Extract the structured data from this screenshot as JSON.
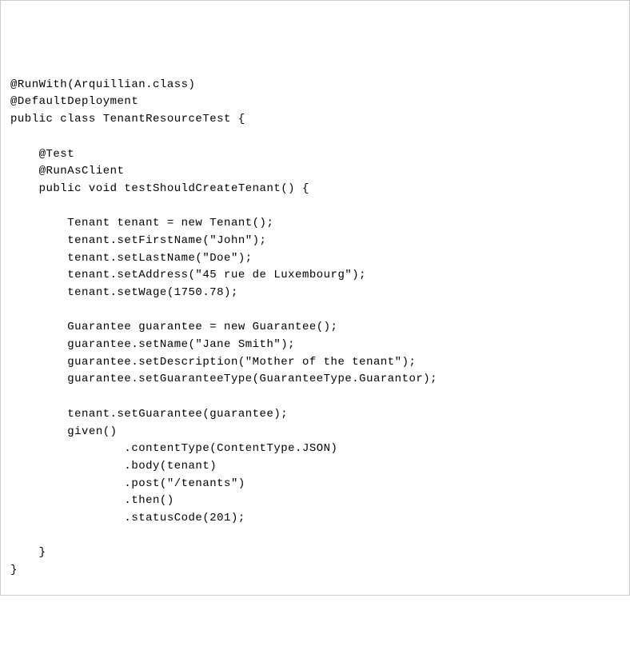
{
  "code": {
    "line1": "@RunWith(Arquillian.class)",
    "line2": "@DefaultDeployment",
    "line3": "public class TenantResourceTest {",
    "line4": "",
    "line5": "    @Test",
    "line6": "    @RunAsClient",
    "line7": "    public void testShouldCreateTenant() {",
    "line8": "",
    "line9": "        Tenant tenant = new Tenant();",
    "line10": "        tenant.setFirstName(\"John\");",
    "line11": "        tenant.setLastName(\"Doe\");",
    "line12": "        tenant.setAddress(\"45 rue de Luxembourg\");",
    "line13": "        tenant.setWage(1750.78);",
    "line14": "",
    "line15": "        Guarantee guarantee = new Guarantee();",
    "line16": "        guarantee.setName(\"Jane Smith\");",
    "line17": "        guarantee.setDescription(\"Mother of the tenant\");",
    "line18": "        guarantee.setGuaranteeType(GuaranteeType.Guarantor);",
    "line19": "",
    "line20": "        tenant.setGuarantee(guarantee);",
    "line21": "        given()",
    "line22": "                .contentType(ContentType.JSON)",
    "line23": "                .body(tenant)",
    "line24": "                .post(\"/tenants\")",
    "line25": "                .then()",
    "line26": "                .statusCode(201);",
    "line27": "",
    "line28": "    }",
    "line29": "}"
  }
}
